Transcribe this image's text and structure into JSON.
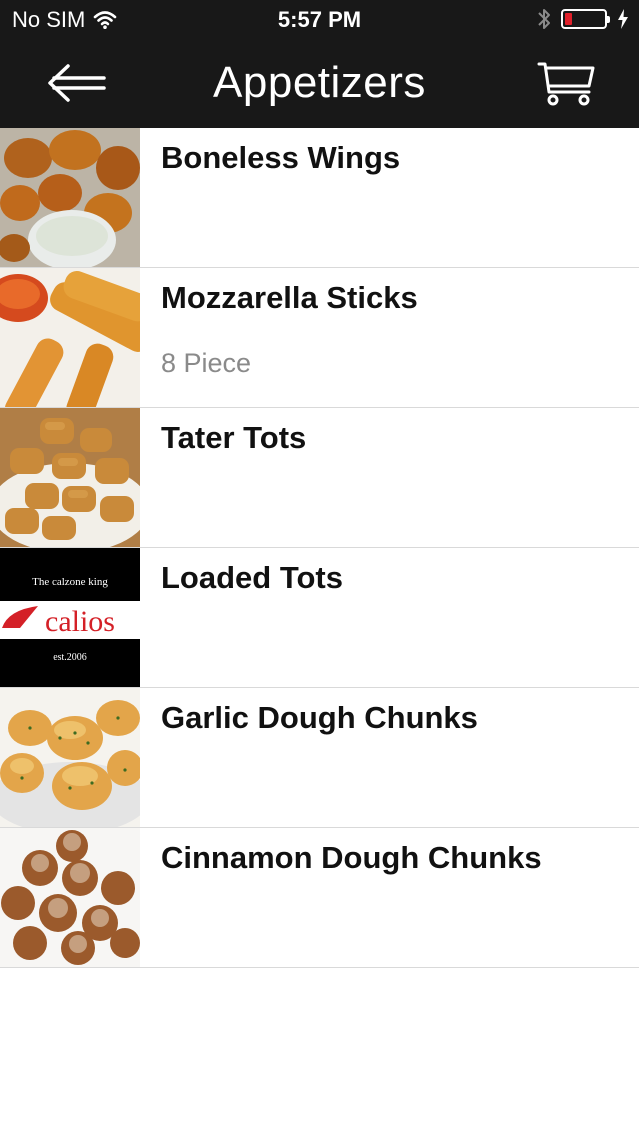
{
  "status_bar": {
    "carrier": "No SIM",
    "time": "5:57 PM",
    "battery_color": "#e0202a"
  },
  "nav": {
    "title": "Appetizers",
    "back_icon": "back-arrow-icon",
    "cart_icon": "cart-icon"
  },
  "items": [
    {
      "name": "Boneless Wings",
      "description": "",
      "image": "boneless-wings-photo"
    },
    {
      "name": "Mozzarella Sticks",
      "description": "8 Piece",
      "image": "mozzarella-sticks-photo"
    },
    {
      "name": "Tater Tots",
      "description": "",
      "image": "tater-tots-photo"
    },
    {
      "name": "Loaded Tots",
      "description": "",
      "image": "calios-logo-placeholder",
      "logo": {
        "tagline": "The calzone king",
        "brand": "calios",
        "est": "est.2006"
      }
    },
    {
      "name": "Garlic Dough Chunks",
      "description": "",
      "image": "garlic-dough-chunks-photo"
    },
    {
      "name": "Cinnamon Dough Chunks",
      "description": "",
      "image": "cinnamon-dough-chunks-photo"
    }
  ]
}
